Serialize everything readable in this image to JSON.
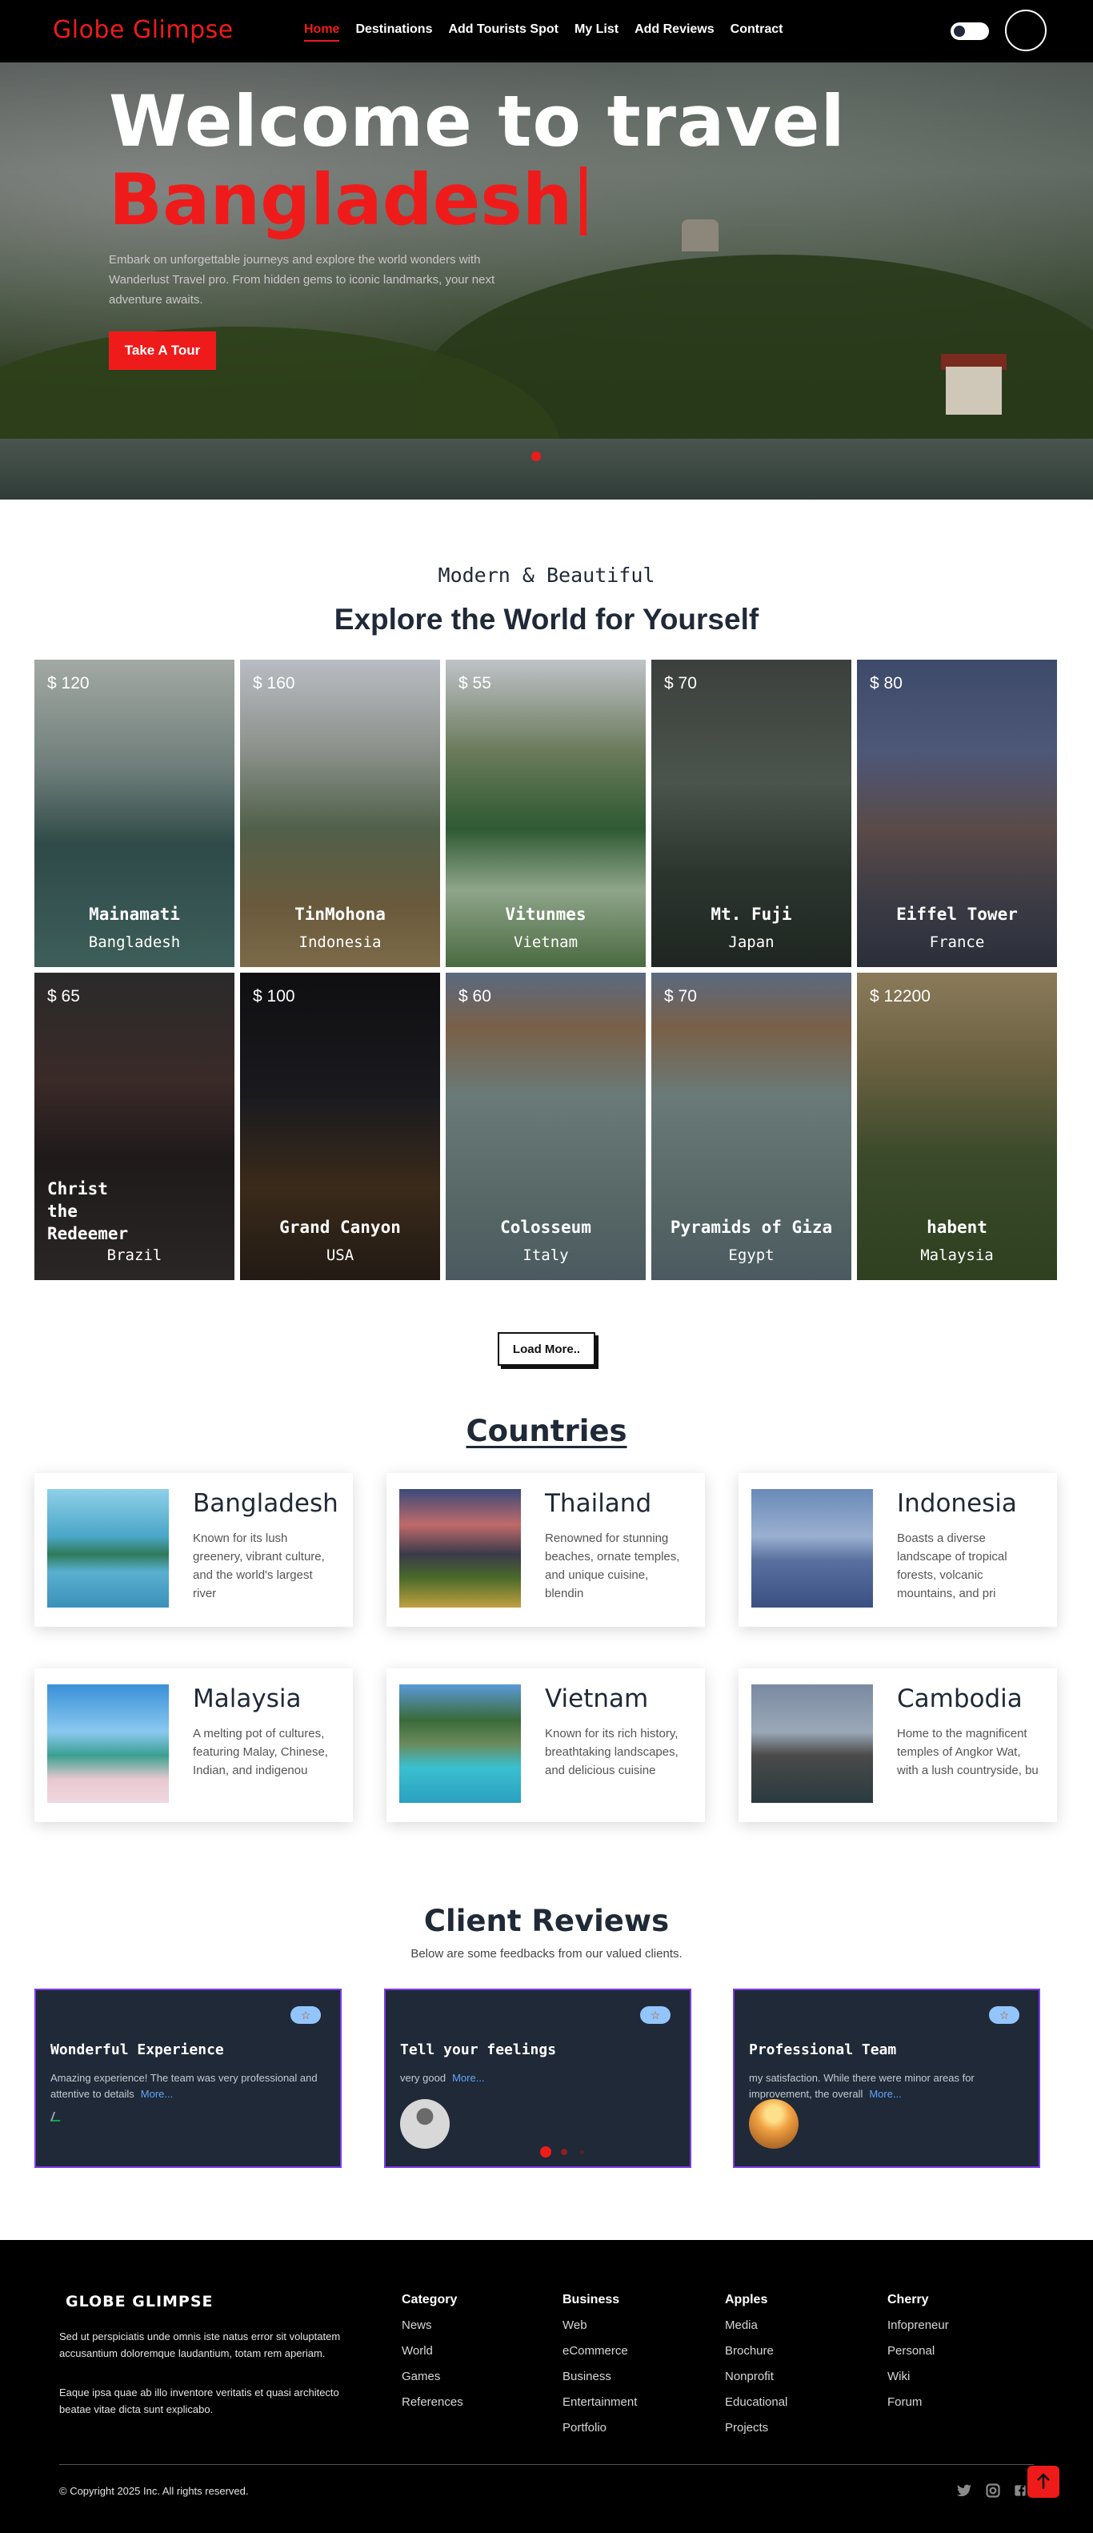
{
  "nav": {
    "brand": "Globe Glimpse",
    "links": [
      "Home",
      "Destinations",
      "Add Tourists Spot",
      "My List",
      "Add Reviews",
      "Contract"
    ]
  },
  "hero": {
    "title_line1": "Welcome to travel",
    "title_line2": "Bangladesh",
    "description": "Embark on unforgettable journeys and explore the world wonders with Wanderlust Travel pro. From hidden gems to iconic landmarks, your next adventure awaits.",
    "button": "Take A Tour"
  },
  "explore": {
    "subtitle": "Modern & Beautiful",
    "title": "Explore the World for Yourself",
    "spots": [
      {
        "price": "$ 120",
        "name": "Mainamati",
        "country": "Bangladesh"
      },
      {
        "price": "$ 160",
        "name": "TinMohona",
        "country": "Indonesia"
      },
      {
        "price": "$ 55",
        "name": "Vitunmes",
        "country": "Vietnam"
      },
      {
        "price": "$ 70",
        "name": "Mt. Fuji",
        "country": "Japan"
      },
      {
        "price": "$ 80",
        "name": "Eiffel Tower",
        "country": "France"
      },
      {
        "price": "$ 65",
        "name": "Christ the Redeemer",
        "country": "Brazil"
      },
      {
        "price": "$ 100",
        "name": "Grand Canyon",
        "country": "USA"
      },
      {
        "price": "$ 60",
        "name": "Colosseum",
        "country": "Italy"
      },
      {
        "price": "$ 70",
        "name": "Pyramids of Giza",
        "country": "Egypt"
      },
      {
        "price": "$ 12200",
        "name": "habent",
        "country": "Malaysia"
      }
    ],
    "load_more": "Load More.."
  },
  "countries": {
    "title": "Countries",
    "items": [
      {
        "name": "Bangladesh",
        "desc": "Known for its lush greenery, vibrant culture, and the world's largest river"
      },
      {
        "name": "Thailand",
        "desc": "Renowned for stunning beaches, ornate temples, and unique cuisine, blendin"
      },
      {
        "name": "Indonesia",
        "desc": "Boasts a diverse landscape of tropical forests, volcanic mountains, and pri"
      },
      {
        "name": "Malaysia",
        "desc": "A melting pot of cultures, featuring Malay, Chinese, Indian, and indigenou"
      },
      {
        "name": "Vietnam",
        "desc": "Known for its rich history, breathtaking landscapes, and delicious cuisine"
      },
      {
        "name": "Cambodia",
        "desc": "Home to the magnificent temples of Angkor Wat, with a lush countryside, bu"
      }
    ]
  },
  "reviews": {
    "title": "Client Reviews",
    "subtitle": "Below are some feedbacks from our valued clients.",
    "star": "☆",
    "more": "More...",
    "items": [
      {
        "title": "Wonderful Experience",
        "text": "Amazing experience! The team was very professional and attentive to details"
      },
      {
        "title": "Tell your feelings",
        "text": "very good"
      },
      {
        "title": "Professional Team",
        "text": "my satisfaction. While there were minor areas for improvement, the overall"
      }
    ]
  },
  "footer": {
    "brand": "GLOBE GLIMPSE",
    "text1": "Sed ut perspiciatis unde omnis iste natus error sit voluptatem accusantium doloremque laudantium, totam rem aperiam.",
    "text2": "Eaque ipsa quae ab illo inventore veritatis et quasi architecto beatae vitae dicta sunt explicabo.",
    "columns": [
      {
        "head": "Category",
        "items": [
          "News",
          "World",
          "Games",
          "References"
        ]
      },
      {
        "head": "Business",
        "items": [
          "Web",
          "eCommerce",
          "Business",
          "Entertainment",
          "Portfolio"
        ]
      },
      {
        "head": "Apples",
        "items": [
          "Media",
          "Brochure",
          "Nonprofit",
          "Educational",
          "Projects"
        ]
      },
      {
        "head": "Cherry",
        "items": [
          "Infopreneur",
          "Personal",
          "Wiki",
          "Forum"
        ]
      }
    ],
    "copyright": "© Copyright 2025 Inc. All rights reserved.",
    "social_icons": [
      "twitter-icon",
      "instagram-icon",
      "facebook-icon"
    ],
    "scroll_top_icon": "arrow-up-icon"
  },
  "colors": {
    "accent": "#ef1b1b",
    "dark": "#1f2937",
    "review_border": "#7c3aed",
    "link": "#60a5fa"
  }
}
